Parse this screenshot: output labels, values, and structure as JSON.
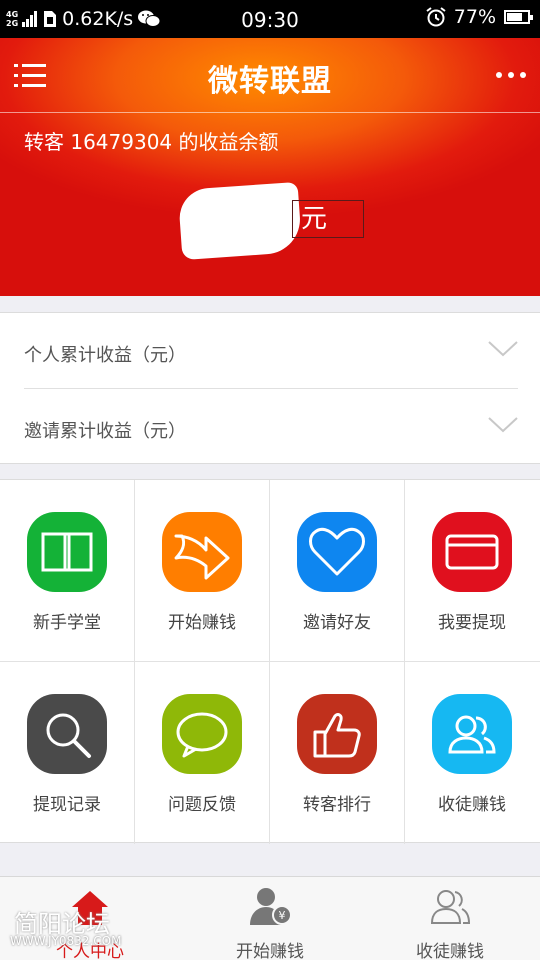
{
  "status_bar": {
    "network": [
      "4G",
      "2G"
    ],
    "speed": "0.62K/s",
    "time": "09:30",
    "battery": "77%",
    "battery_level": 0.77
  },
  "header": {
    "title": "微转联盟",
    "balance_label": "转客 16479304 的收益余额",
    "balance_unit": "元"
  },
  "earnings": [
    {
      "label": "个人累计收益（元）"
    },
    {
      "label": "邀请累计收益（元）"
    }
  ],
  "grid": [
    {
      "label": "新手学堂",
      "icon": "book-icon",
      "color": "#14b237"
    },
    {
      "label": "开始赚钱",
      "icon": "forward-arrow-icon",
      "color": "#ff7e00"
    },
    {
      "label": "邀请好友",
      "icon": "heart-icon",
      "color": "#0e86f0"
    },
    {
      "label": "我要提现",
      "icon": "card-icon",
      "color": "#e0101e"
    },
    {
      "label": "提现记录",
      "icon": "search-icon",
      "color": "#4a4a4a"
    },
    {
      "label": "问题反馈",
      "icon": "chat-bubble-icon",
      "color": "#8fb808"
    },
    {
      "label": "转客排行",
      "icon": "thumbs-up-icon",
      "color": "#c0301c"
    },
    {
      "label": "收徒赚钱",
      "icon": "users-icon",
      "color": "#16b8f2"
    }
  ],
  "tabs": [
    {
      "label": "个人中心",
      "icon": "home-icon",
      "active": true
    },
    {
      "label": "开始赚钱",
      "icon": "user-money-icon",
      "active": false
    },
    {
      "label": "收徒赚钱",
      "icon": "users-icon",
      "active": false
    }
  ],
  "watermark": {
    "title": "简阳论坛",
    "url": "WWW.JY0832.COM"
  }
}
